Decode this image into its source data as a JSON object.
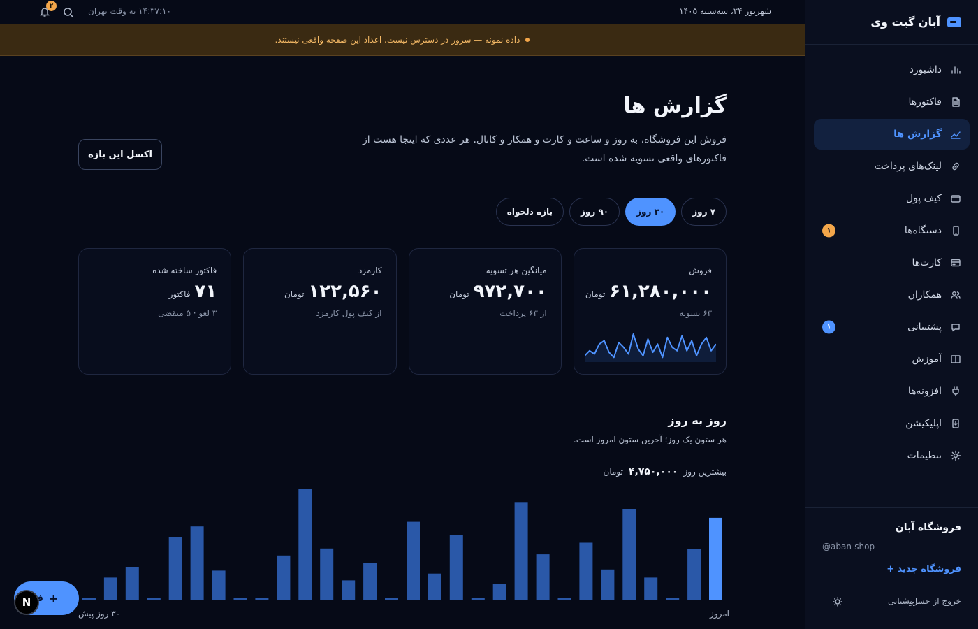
{
  "brand": {
    "name": "آبان گیت وی"
  },
  "sidebar": {
    "items": [
      {
        "label": "داشبورد",
        "icon": "bar-chart-icon"
      },
      {
        "label": "فاکتورها",
        "icon": "document-icon"
      },
      {
        "label": "گزارش ها",
        "icon": "trend-icon",
        "active": true
      },
      {
        "label": "لینک‌های پرداخت",
        "icon": "link-icon"
      },
      {
        "label": "کیف پول",
        "icon": "wallet-icon"
      },
      {
        "label": "دستگاه‌ها",
        "icon": "device-icon",
        "badge": "۱"
      },
      {
        "label": "کارت‌ها",
        "icon": "card-icon"
      },
      {
        "label": "همکاران",
        "icon": "users-icon"
      },
      {
        "label": "پشتیبانی",
        "icon": "chat-icon",
        "badge": "۱"
      },
      {
        "label": "آموزش",
        "icon": "book-icon"
      },
      {
        "label": "افزونه‌ها",
        "icon": "plug-icon"
      },
      {
        "label": "اپلیکیشن",
        "icon": "phone-download-icon"
      },
      {
        "label": "تنظیمات",
        "icon": "gear-icon"
      }
    ],
    "footer": {
      "shop_name": "فروشگاه آبان",
      "shop_handle": "@aban-shop",
      "new_shop": "+ فروشگاه جدید",
      "logout": "خروج از حساب",
      "theme": "روشنایی"
    }
  },
  "topbar": {
    "date": "۱۴۰۵ شهریور ۲۴، سه‌شنبه",
    "clock": "۱۴:۳۷:۱۰ به وقت تهران",
    "notifications_count": "۲"
  },
  "banner": {
    "text": "داده نمونه — سرور در دسترس نیست، اعداد این صفحه واقعی نیستند."
  },
  "page": {
    "title": "گزارش ها",
    "description": "فروش این فروشگاه، به روز و ساعت و کارت و همکار و کانال. هر عددی که اینجا هست از فاکتورهای واقعی تسویه شده است.",
    "export_label": "اکسل این بازه"
  },
  "ranges": [
    {
      "label": "۷ روز"
    },
    {
      "label": "۳۰ روز",
      "active": true
    },
    {
      "label": "۹۰ روز"
    },
    {
      "label": "بازه دلخواه"
    }
  ],
  "cards": [
    {
      "label": "فروش",
      "value": "۶۱,۲۸۰,۰۰۰",
      "unit": "تومان",
      "sub": "۶۳ تسویه"
    },
    {
      "label": "میانگین هر تسویه",
      "value": "۹۷۲,۷۰۰",
      "unit": "تومان",
      "sub": "از ۶۳ پرداخت"
    },
    {
      "label": "کارمزد",
      "value": "۱۲۲,۵۶۰",
      "unit": "تومان",
      "sub": "از کیف پول کارمزد"
    },
    {
      "label": "فاکتور ساخته شده",
      "value": "۷۱",
      "unit": "فاکتور",
      "sub": "۳ لغو · ۵ منقضی"
    }
  ],
  "daily": {
    "title": "روز به روز",
    "description": "هر ستون یک روز؛ آخرین ستون امروز است.",
    "peak_label": "بیشترین روز",
    "peak_value": "۴,۷۵۰,۰۰۰",
    "peak_unit": "تومان",
    "axis_start": "۳۰ روز پیش",
    "axis_end": "امروز"
  },
  "fab": {
    "label": "فاکتور",
    "plus": "+"
  },
  "next_badge": "N",
  "colors": {
    "accent": "#4f93ff",
    "bar": "#2a58a8",
    "bar_today": "#4f93ff",
    "warning": "#f3a64a"
  },
  "chart_data": [
    {
      "type": "bar",
      "title": "روز به روز",
      "categories": [
        "1",
        "2",
        "3",
        "4",
        "5",
        "6",
        "7",
        "8",
        "9",
        "10",
        "11",
        "12",
        "13",
        "14",
        "15",
        "16",
        "17",
        "18",
        "19",
        "20",
        "21",
        "22",
        "23",
        "24",
        "25",
        "26",
        "27",
        "28",
        "29",
        "30"
      ],
      "values": [
        50000,
        950000,
        1400000,
        50000,
        2700000,
        3150000,
        1250000,
        50000,
        50000,
        1900000,
        4750000,
        2200000,
        830000,
        1580000,
        50000,
        3350000,
        1120000,
        2780000,
        50000,
        680000,
        4200000,
        1950000,
        50000,
        2450000,
        1300000,
        3880000,
        950000,
        50000,
        2180000,
        3520000
      ],
      "ylim": [
        0,
        4750000
      ],
      "xlabel": "",
      "ylabel": "",
      "grid": false
    },
    {
      "type": "line",
      "title": "",
      "values": [
        3,
        6,
        4,
        10,
        12,
        5,
        2,
        11,
        8,
        4,
        16,
        7,
        3,
        13,
        5,
        10,
        2,
        14,
        8,
        6,
        15,
        6,
        12,
        3,
        10,
        14,
        6,
        10
      ],
      "grid": false
    }
  ]
}
